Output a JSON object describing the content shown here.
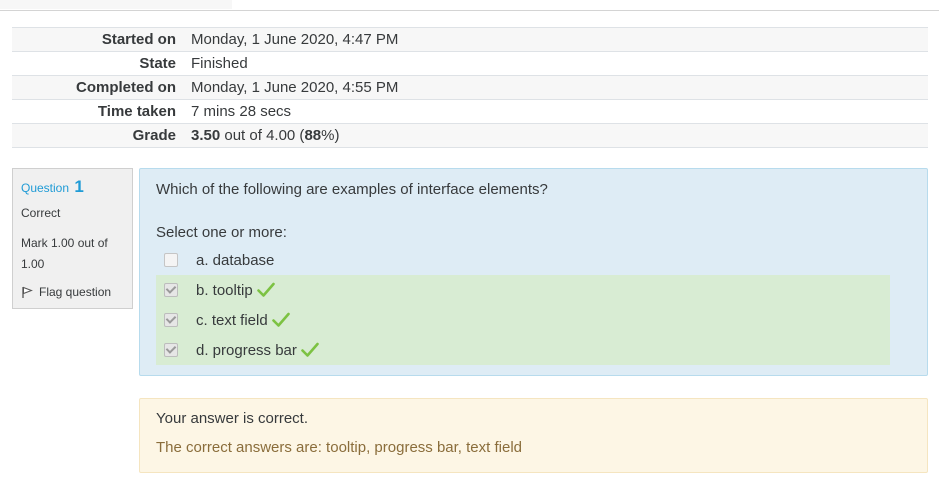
{
  "summary": {
    "rows": [
      {
        "label": "Started on",
        "value": "Monday, 1 June 2020, 4:47 PM"
      },
      {
        "label": "State",
        "value": "Finished"
      },
      {
        "label": "Completed on",
        "value": "Monday, 1 June 2020, 4:55 PM"
      },
      {
        "label": "Time taken",
        "value": "7 mins 28 secs"
      }
    ],
    "grade": {
      "label": "Grade",
      "score": "3.50",
      "out_of_text": " out of 4.00 (",
      "percent": "88",
      "suffix": "%)"
    }
  },
  "question_info": {
    "prefix": "Question",
    "number": "1",
    "state": "Correct",
    "mark": "Mark 1.00 out of 1.00",
    "flag_label": "Flag question"
  },
  "question": {
    "text": "Which of the following are examples of interface elements?",
    "prompt": "Select one or more:",
    "options": [
      {
        "label": "a. database",
        "checked": false,
        "correct": false
      },
      {
        "label": "b. tooltip",
        "checked": true,
        "correct": true
      },
      {
        "label": "c. text field",
        "checked": true,
        "correct": true
      },
      {
        "label": "d. progress bar",
        "checked": true,
        "correct": true
      }
    ]
  },
  "feedback": {
    "result": "Your answer is correct.",
    "right_answer": "The correct answers are: tooltip, progress bar, text field"
  },
  "colors": {
    "accent": "#1f9bd6",
    "question_bg": "#deecf5",
    "correct_bg": "#d8ecd3",
    "tick": "#7cc242",
    "feedback_bg": "#fdf6e5",
    "feedback_text": "#8a6d3b"
  }
}
